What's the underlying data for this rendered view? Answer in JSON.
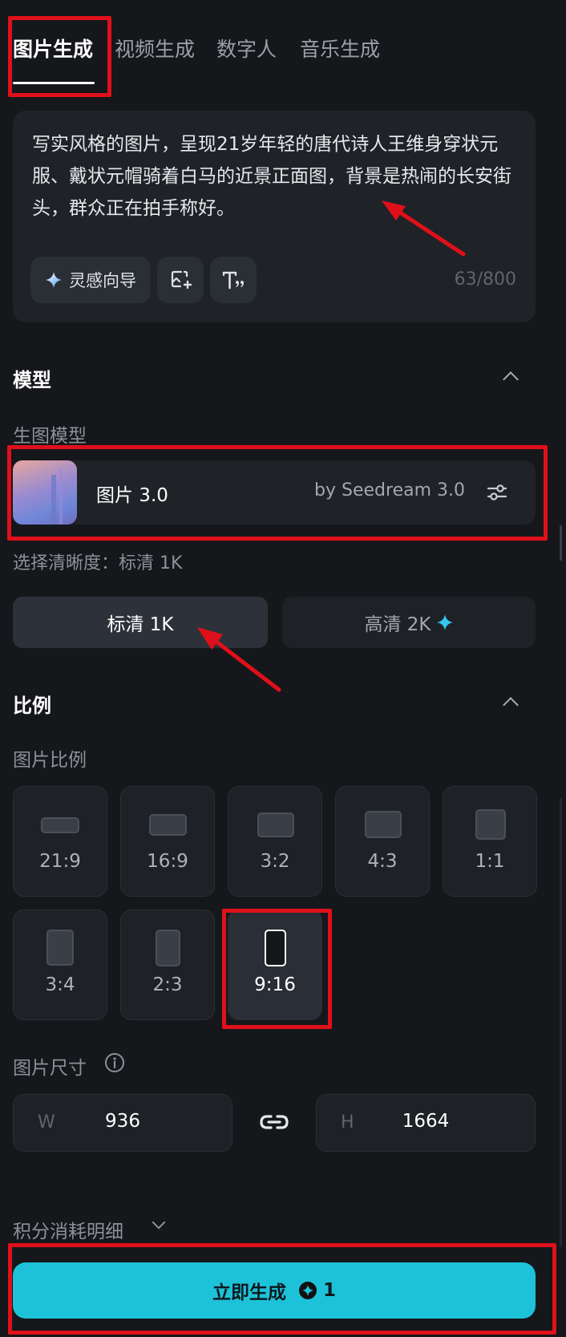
{
  "tabs": [
    {
      "label": "图片生成",
      "active": true
    },
    {
      "label": "视频生成"
    },
    {
      "label": "数字人"
    },
    {
      "label": "音乐生成"
    }
  ],
  "prompt": {
    "text": "写实风格的图片，呈现21岁年轻的唐代诗人王维身穿状元服、戴状元帽骑着白马的近景正面图，背景是热闹的长安街头，群众正在拍手称好。",
    "counter": "63/800",
    "inspiration_label": "灵感向导"
  },
  "model_section": {
    "title": "模型",
    "sub_label": "生图模型",
    "model_name": "图片 3.0",
    "model_by": "by Seedream 3.0",
    "quality_label": "选择清晰度：标清 1K",
    "quality_options": [
      {
        "label": "标清 1K",
        "selected": true
      },
      {
        "label": "高清 2K",
        "selected": false
      }
    ]
  },
  "ratio_section": {
    "title": "比例",
    "sub_label": "图片比例",
    "ratios": [
      "21:9",
      "16:9",
      "3:2",
      "4:3",
      "1:1",
      "3:4",
      "2:3",
      "9:16"
    ],
    "selected": "9:16"
  },
  "size_section": {
    "label": "图片尺寸",
    "width_key": "W",
    "width": "936",
    "height_key": "H",
    "height": "1664"
  },
  "credits": {
    "label": "积分消耗明细"
  },
  "generate": {
    "label": "立即生成",
    "cost": "1"
  },
  "colors": {
    "background": "#15171b",
    "accent": "#1ec2d8",
    "annotation_red": "#e0101a",
    "sparkle": "#35c6f0"
  }
}
